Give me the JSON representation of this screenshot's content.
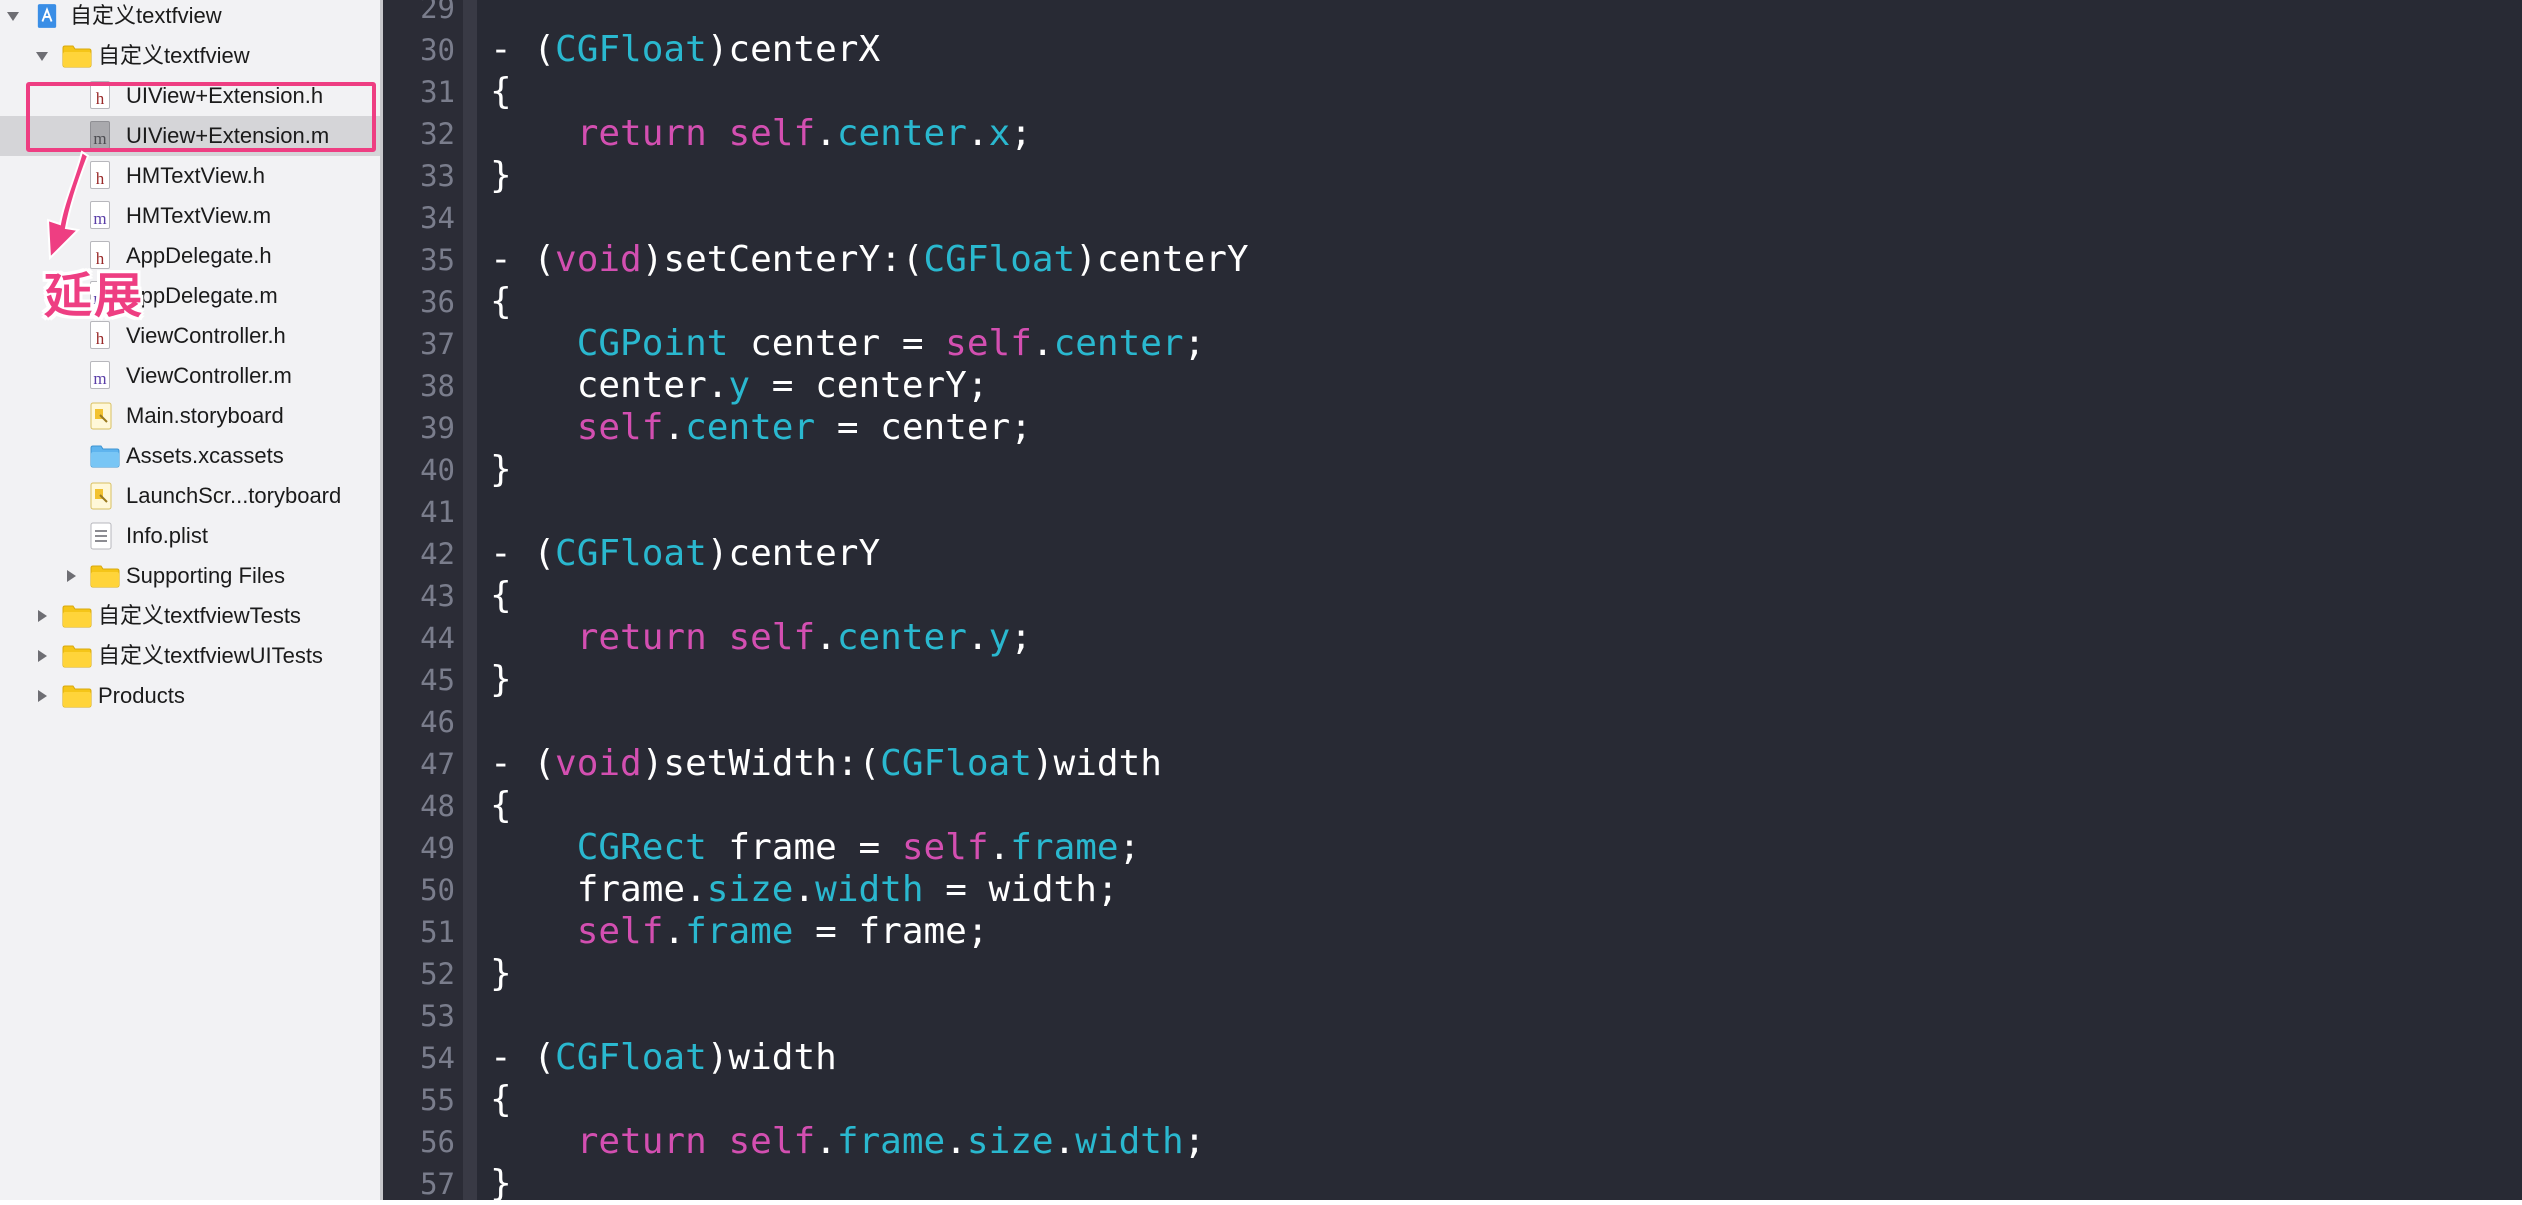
{
  "colors": {
    "sidebar_bg": "#f2f2f4",
    "editor_bg": "#282a34",
    "keyword": "#d34fb1",
    "type": "#2ab8cf",
    "plain": "#ffffff",
    "line_number": "#7a7d8c",
    "annotation": "#ee3e82"
  },
  "navigator": {
    "items": [
      {
        "label": "自定义textfview",
        "kind": "project",
        "indent": 0,
        "disclosure": "open"
      },
      {
        "label": "自定义textfview",
        "kind": "folder",
        "indent": 1,
        "disclosure": "open"
      },
      {
        "label": "UIView+Extension.h",
        "kind": "h",
        "indent": 2
      },
      {
        "label": "UIView+Extension.m",
        "kind": "m",
        "indent": 2,
        "selected": true
      },
      {
        "label": "HMTextView.h",
        "kind": "h",
        "indent": 2
      },
      {
        "label": "HMTextView.m",
        "kind": "m",
        "indent": 2
      },
      {
        "label": "AppDelegate.h",
        "kind": "h",
        "indent": 2
      },
      {
        "label": "AppDelegate.m",
        "kind": "m",
        "indent": 2
      },
      {
        "label": "ViewController.h",
        "kind": "h",
        "indent": 2
      },
      {
        "label": "ViewController.m",
        "kind": "m",
        "indent": 2
      },
      {
        "label": "Main.storyboard",
        "kind": "storyboard",
        "indent": 2
      },
      {
        "label": "Assets.xcassets",
        "kind": "xcassets",
        "indent": 2
      },
      {
        "label": "LaunchScr...toryboard",
        "kind": "storyboard",
        "indent": 2
      },
      {
        "label": "Info.plist",
        "kind": "plist",
        "indent": 2
      },
      {
        "label": "Supporting Files",
        "kind": "folder",
        "indent": 2,
        "disclosure": "closed"
      },
      {
        "label": "自定义textfviewTests",
        "kind": "folder",
        "indent": 1,
        "disclosure": "closed"
      },
      {
        "label": "自定义textfviewUITests",
        "kind": "folder",
        "indent": 1,
        "disclosure": "closed"
      },
      {
        "label": "Products",
        "kind": "folder",
        "indent": 1,
        "disclosure": "closed"
      }
    ]
  },
  "annotation": {
    "text": "延展"
  },
  "editor": {
    "lines": [
      {
        "n": "29",
        "tokens": []
      },
      {
        "n": "30",
        "tokens": [
          [
            "pl",
            "- ("
          ],
          [
            "ty",
            "CGFloat"
          ],
          [
            "pl",
            ")centerX"
          ]
        ]
      },
      {
        "n": "31",
        "tokens": [
          [
            "pl",
            "{"
          ]
        ]
      },
      {
        "n": "32",
        "tokens": [
          [
            "pl",
            "    "
          ],
          [
            "kw",
            "return"
          ],
          [
            "pl",
            " "
          ],
          [
            "kw",
            "self"
          ],
          [
            "pl",
            "."
          ],
          [
            "pr",
            "center"
          ],
          [
            "pl",
            "."
          ],
          [
            "pr",
            "x"
          ],
          [
            "pl",
            ";"
          ]
        ]
      },
      {
        "n": "33",
        "tokens": [
          [
            "pl",
            "}"
          ]
        ]
      },
      {
        "n": "34",
        "tokens": []
      },
      {
        "n": "35",
        "tokens": [
          [
            "pl",
            "- ("
          ],
          [
            "kw",
            "void"
          ],
          [
            "pl",
            ")setCenterY:("
          ],
          [
            "ty",
            "CGFloat"
          ],
          [
            "pl",
            ")centerY"
          ]
        ]
      },
      {
        "n": "36",
        "tokens": [
          [
            "pl",
            "{"
          ]
        ]
      },
      {
        "n": "37",
        "tokens": [
          [
            "pl",
            "    "
          ],
          [
            "ty",
            "CGPoint"
          ],
          [
            "pl",
            " center = "
          ],
          [
            "kw",
            "self"
          ],
          [
            "pl",
            "."
          ],
          [
            "pr",
            "center"
          ],
          [
            "pl",
            ";"
          ]
        ]
      },
      {
        "n": "38",
        "tokens": [
          [
            "pl",
            "    center."
          ],
          [
            "pr",
            "y"
          ],
          [
            "pl",
            " = centerY;"
          ]
        ]
      },
      {
        "n": "39",
        "tokens": [
          [
            "pl",
            "    "
          ],
          [
            "kw",
            "self"
          ],
          [
            "pl",
            "."
          ],
          [
            "pr",
            "center"
          ],
          [
            "pl",
            " = center;"
          ]
        ]
      },
      {
        "n": "40",
        "tokens": [
          [
            "pl",
            "}"
          ]
        ]
      },
      {
        "n": "41",
        "tokens": []
      },
      {
        "n": "42",
        "tokens": [
          [
            "pl",
            "- ("
          ],
          [
            "ty",
            "CGFloat"
          ],
          [
            "pl",
            ")centerY"
          ]
        ]
      },
      {
        "n": "43",
        "tokens": [
          [
            "pl",
            "{"
          ]
        ]
      },
      {
        "n": "44",
        "tokens": [
          [
            "pl",
            "    "
          ],
          [
            "kw",
            "return"
          ],
          [
            "pl",
            " "
          ],
          [
            "kw",
            "self"
          ],
          [
            "pl",
            "."
          ],
          [
            "pr",
            "center"
          ],
          [
            "pl",
            "."
          ],
          [
            "pr",
            "y"
          ],
          [
            "pl",
            ";"
          ]
        ]
      },
      {
        "n": "45",
        "tokens": [
          [
            "pl",
            "}"
          ]
        ]
      },
      {
        "n": "46",
        "tokens": []
      },
      {
        "n": "47",
        "tokens": [
          [
            "pl",
            "- ("
          ],
          [
            "kw",
            "void"
          ],
          [
            "pl",
            ")setWidth:("
          ],
          [
            "ty",
            "CGFloat"
          ],
          [
            "pl",
            ")width"
          ]
        ]
      },
      {
        "n": "48",
        "tokens": [
          [
            "pl",
            "{"
          ]
        ]
      },
      {
        "n": "49",
        "tokens": [
          [
            "pl",
            "    "
          ],
          [
            "ty",
            "CGRect"
          ],
          [
            "pl",
            " frame = "
          ],
          [
            "kw",
            "self"
          ],
          [
            "pl",
            "."
          ],
          [
            "pr",
            "frame"
          ],
          [
            "pl",
            ";"
          ]
        ]
      },
      {
        "n": "50",
        "tokens": [
          [
            "pl",
            "    frame."
          ],
          [
            "pr",
            "size"
          ],
          [
            "pl",
            "."
          ],
          [
            "pr",
            "width"
          ],
          [
            "pl",
            " = width;"
          ]
        ]
      },
      {
        "n": "51",
        "tokens": [
          [
            "pl",
            "    "
          ],
          [
            "kw",
            "self"
          ],
          [
            "pl",
            "."
          ],
          [
            "pr",
            "frame"
          ],
          [
            "pl",
            " = frame;"
          ]
        ]
      },
      {
        "n": "52",
        "tokens": [
          [
            "pl",
            "}"
          ]
        ]
      },
      {
        "n": "53",
        "tokens": []
      },
      {
        "n": "54",
        "tokens": [
          [
            "pl",
            "- ("
          ],
          [
            "ty",
            "CGFloat"
          ],
          [
            "pl",
            ")width"
          ]
        ]
      },
      {
        "n": "55",
        "tokens": [
          [
            "pl",
            "{"
          ]
        ]
      },
      {
        "n": "56",
        "tokens": [
          [
            "pl",
            "    "
          ],
          [
            "kw",
            "return"
          ],
          [
            "pl",
            " "
          ],
          [
            "kw",
            "self"
          ],
          [
            "pl",
            "."
          ],
          [
            "pr",
            "frame"
          ],
          [
            "pl",
            "."
          ],
          [
            "pr",
            "size"
          ],
          [
            "pl",
            "."
          ],
          [
            "pr",
            "width"
          ],
          [
            "pl",
            ";"
          ]
        ]
      },
      {
        "n": "57",
        "tokens": [
          [
            "pl",
            "}"
          ]
        ]
      }
    ]
  }
}
